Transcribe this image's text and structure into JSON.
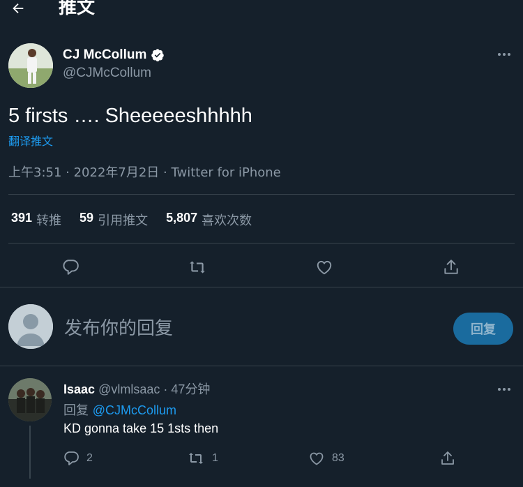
{
  "header": {
    "title": "推文",
    "back_icon": "arrow-left-icon"
  },
  "tweet": {
    "author_name": "CJ McCollum",
    "author_handle": "@CJMcCollum",
    "verified": true,
    "text": "5 firsts …. Sheeeeeshhhhh",
    "translate_label": "翻译推文",
    "timestamp": "上午3:51 · 2022年7月2日 · Twitter for iPhone",
    "stats": {
      "retweets_count": "391",
      "retweets_label": "转推",
      "quotes_count": "59",
      "quotes_label": "引用推文",
      "likes_count": "5,807",
      "likes_label": "喜欢次数"
    }
  },
  "composer": {
    "placeholder": "发布你的回复",
    "reply_button": "回复"
  },
  "reply": {
    "name": "Isaac",
    "handle_time": "@vlmlsaac · 47分钟",
    "replying_prefix": "回复",
    "replying_to": "@CJMcCollum",
    "text": "KD gonna take 15 1sts then",
    "replies_count": "2",
    "retweets_count": "1",
    "likes_count": "83"
  },
  "colors": {
    "background": "#15202b",
    "accent": "#1d9bf0",
    "muted_text": "#8b98a5",
    "divider": "#38444d"
  }
}
